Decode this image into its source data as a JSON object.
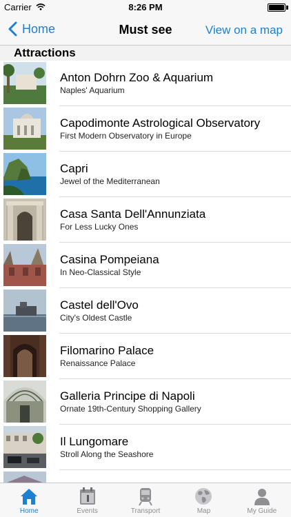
{
  "status_bar": {
    "carrier": "Carrier",
    "time": "8:26 PM"
  },
  "nav": {
    "back_label": "Home",
    "title": "Must see",
    "right_label": "View on a map"
  },
  "section": {
    "title": "Attractions"
  },
  "items": [
    {
      "title": "Anton Dohrn Zoo & Aquarium",
      "subtitle": "Naples' Aquarium"
    },
    {
      "title": "Capodimonte Astrological Observatory",
      "subtitle": "First Modern Observatory in Europe"
    },
    {
      "title": "Capri",
      "subtitle": "Jewel of the Mediterranean"
    },
    {
      "title": "Casa Santa Dell'Annunziata",
      "subtitle": "For Less Lucky Ones"
    },
    {
      "title": "Casina Pompeiana",
      "subtitle": "In Neo-Classical Style"
    },
    {
      "title": "Castel dell'Ovo",
      "subtitle": "City's Oldest Castle"
    },
    {
      "title": "Filomarino Palace",
      "subtitle": "Renaissance Palace"
    },
    {
      "title": "Galleria Principe di Napoli",
      "subtitle": "Ornate 19th-Century Shopping Gallery"
    },
    {
      "title": "Il Lungomare",
      "subtitle": "Stroll Along the Seashore"
    }
  ],
  "tabs": [
    {
      "label": "Home",
      "icon": "home-icon",
      "active": true
    },
    {
      "label": "Events",
      "icon": "calendar-icon"
    },
    {
      "label": "Transport",
      "icon": "train-icon"
    },
    {
      "label": "Map",
      "icon": "globe-icon"
    },
    {
      "label": "My Guide",
      "icon": "person-icon"
    }
  ],
  "colors": {
    "accent": "#1f7fd0",
    "tab_inactive": "#8e8e93"
  }
}
